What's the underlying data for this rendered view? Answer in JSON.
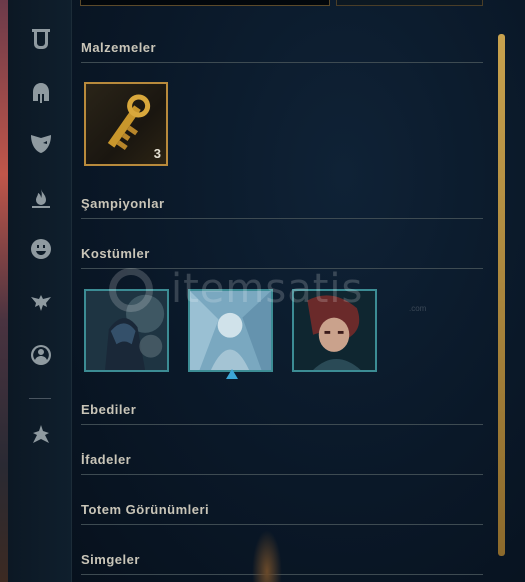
{
  "sidebar": {
    "items": [
      {
        "name": "collection-bag-icon"
      },
      {
        "name": "champions-helmet-icon"
      },
      {
        "name": "skins-mask-icon"
      },
      {
        "name": "emotes-flame-icon"
      },
      {
        "name": "icons-face-icon"
      },
      {
        "name": "wards-icon"
      },
      {
        "name": "profile-icon"
      },
      {
        "name": "loot-arrow-icon"
      }
    ]
  },
  "sections": {
    "materials": {
      "title": "Malzemeler",
      "items": [
        {
          "icon": "key-fragment-icon",
          "count": "3"
        }
      ]
    },
    "champions": {
      "title": "Şampiyonlar"
    },
    "skins": {
      "title": "Kostümler"
    },
    "eternals": {
      "title": "Ebediler"
    },
    "emotes": {
      "title": "İfadeler"
    },
    "ward_skins": {
      "title": "Totem Görünümleri"
    },
    "icons": {
      "title": "Simgeler"
    }
  },
  "watermark": {
    "text": "itemsatis",
    "sub": ".com"
  },
  "colors": {
    "accent_gold": "#c8aa6e",
    "skin_border": "#3c8c94",
    "text": "#c9c5b8"
  }
}
